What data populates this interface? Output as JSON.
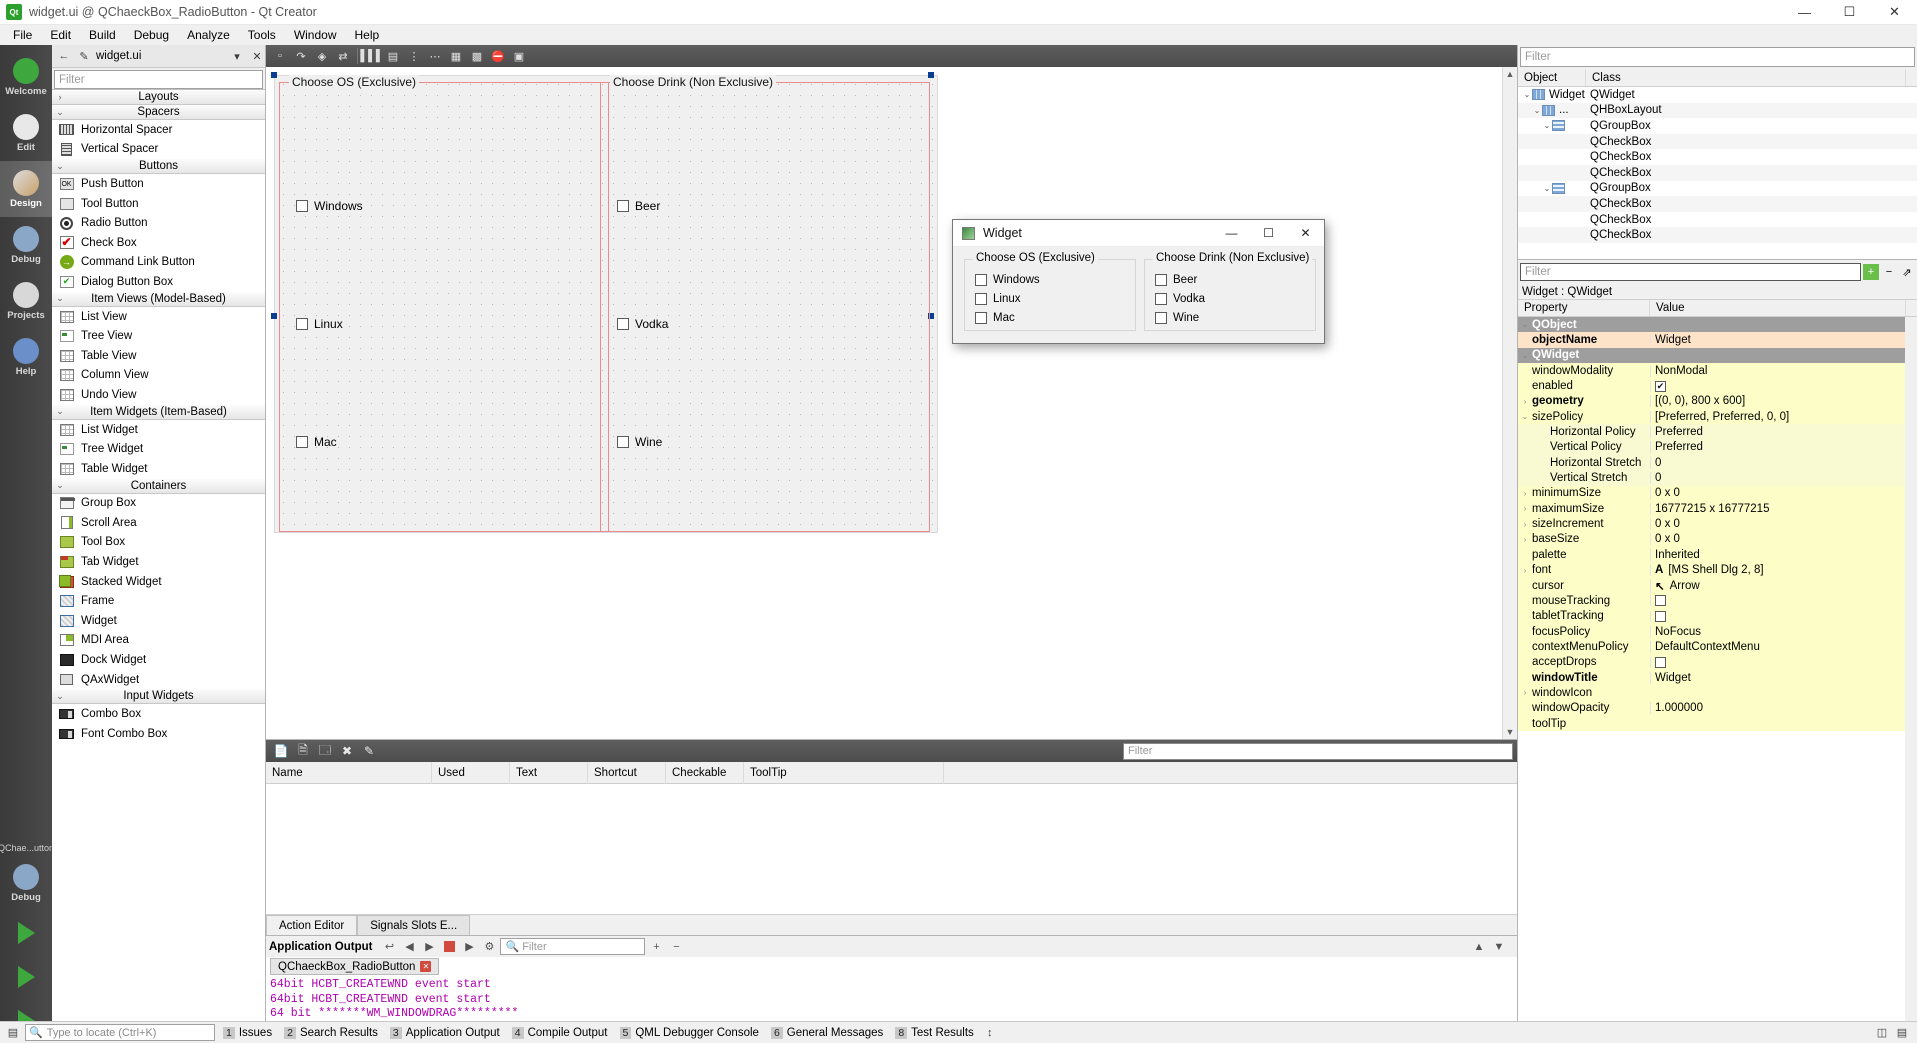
{
  "window": {
    "title": "widget.ui @ QChaeckBox_RadioButton - Qt Creator",
    "icon": "qt-logo-icon",
    "minimize": "—",
    "maximize": "☐",
    "close": "✕"
  },
  "menubar": [
    "File",
    "Edit",
    "Build",
    "Debug",
    "Analyze",
    "Tools",
    "Window",
    "Help"
  ],
  "modebar": {
    "items": [
      {
        "label": "Welcome",
        "icon": "qt-welcome-icon"
      },
      {
        "label": "Edit",
        "icon": "edit-icon"
      },
      {
        "label": "Design",
        "icon": "design-brush-icon"
      },
      {
        "label": "Debug",
        "icon": "debug-bug-icon"
      },
      {
        "label": "Projects",
        "icon": "projects-book-icon"
      },
      {
        "label": "Help",
        "icon": "help-question-icon"
      }
    ],
    "active": "Design",
    "kit_label": "QChae...utton",
    "run_config": "Debug"
  },
  "editor_tab": {
    "filename": "widget.ui",
    "icon": "file-ui-icon"
  },
  "widgetbox": {
    "filter_placeholder": "Filter",
    "categories": [
      {
        "name": "Layouts",
        "expanded": false,
        "items": []
      },
      {
        "name": "Spacers",
        "expanded": true,
        "items": [
          {
            "label": "Horizontal Spacer",
            "icon": "horizontal-spacer-icon"
          },
          {
            "label": "Vertical Spacer",
            "icon": "vertical-spacer-icon"
          }
        ]
      },
      {
        "name": "Buttons",
        "expanded": true,
        "items": [
          {
            "label": "Push Button",
            "icon": "push-button-icon"
          },
          {
            "label": "Tool Button",
            "icon": "tool-button-icon"
          },
          {
            "label": "Radio Button",
            "icon": "radio-button-icon"
          },
          {
            "label": "Check Box",
            "icon": "check-box-icon"
          },
          {
            "label": "Command Link Button",
            "icon": "command-link-icon"
          },
          {
            "label": "Dialog Button Box",
            "icon": "dialog-button-box-icon"
          }
        ]
      },
      {
        "name": "Item Views (Model-Based)",
        "expanded": true,
        "items": [
          {
            "label": "List View",
            "icon": "list-view-icon"
          },
          {
            "label": "Tree View",
            "icon": "tree-view-icon"
          },
          {
            "label": "Table View",
            "icon": "table-view-icon"
          },
          {
            "label": "Column View",
            "icon": "column-view-icon"
          },
          {
            "label": "Undo View",
            "icon": "undo-view-icon"
          }
        ]
      },
      {
        "name": "Item Widgets (Item-Based)",
        "expanded": true,
        "items": [
          {
            "label": "List Widget",
            "icon": "list-widget-icon"
          },
          {
            "label": "Tree Widget",
            "icon": "tree-widget-icon"
          },
          {
            "label": "Table Widget",
            "icon": "table-widget-icon"
          }
        ]
      },
      {
        "name": "Containers",
        "expanded": true,
        "items": [
          {
            "label": "Group Box",
            "icon": "group-box-icon"
          },
          {
            "label": "Scroll Area",
            "icon": "scroll-area-icon"
          },
          {
            "label": "Tool Box",
            "icon": "tool-box-icon"
          },
          {
            "label": "Tab Widget",
            "icon": "tab-widget-icon"
          },
          {
            "label": "Stacked Widget",
            "icon": "stacked-widget-icon"
          },
          {
            "label": "Frame",
            "icon": "frame-icon"
          },
          {
            "label": "Widget",
            "icon": "widget-icon"
          },
          {
            "label": "MDI Area",
            "icon": "mdi-area-icon"
          },
          {
            "label": "Dock Widget",
            "icon": "dock-widget-icon"
          },
          {
            "label": "QAxWidget",
            "icon": "qax-widget-icon"
          }
        ]
      },
      {
        "name": "Input Widgets",
        "expanded": true,
        "items": [
          {
            "label": "Combo Box",
            "icon": "combo-box-icon"
          },
          {
            "label": "Font Combo Box",
            "icon": "font-combo-box-icon"
          }
        ]
      }
    ]
  },
  "form": {
    "groupboxes": [
      {
        "title": "Choose OS (Exclusive)",
        "checkboxes": [
          "Windows",
          "Linux",
          "Mac"
        ]
      },
      {
        "title": "Choose Drink (Non Exclusive)",
        "checkboxes": [
          "Beer",
          "Vodka",
          "Wine"
        ]
      }
    ]
  },
  "preview": {
    "title": "Widget",
    "icon": "widget-preview-icon",
    "minimize": "—",
    "maximize": "☐",
    "close": "✕",
    "groupboxes": [
      {
        "title": "Choose OS (Exclusive)",
        "checkboxes": [
          "Windows",
          "Linux",
          "Mac"
        ]
      },
      {
        "title": "Choose Drink (Non Exclusive)",
        "checkboxes": [
          "Beer",
          "Vodka",
          "Wine"
        ]
      }
    ]
  },
  "action_editor": {
    "filter_placeholder": "Filter",
    "columns": [
      "Name",
      "Used",
      "Text",
      "Shortcut",
      "Checkable",
      "ToolTip"
    ],
    "tabs": [
      {
        "label": "Action Editor",
        "active": true
      },
      {
        "label": "Signals  Slots E...",
        "active": false
      }
    ]
  },
  "object_inspector": {
    "filter_placeholder": "Filter",
    "columns": [
      "Object",
      "Class"
    ],
    "rows": [
      {
        "indent": 0,
        "expander": "⌄",
        "icon": "layout-icon",
        "object": "Widget",
        "class": "QWidget"
      },
      {
        "indent": 1,
        "expander": "⌄",
        "icon": "layout-icon",
        "object": "...",
        "class": "QHBoxLayout"
      },
      {
        "indent": 2,
        "expander": "⌄",
        "icon": "groupbox-icon",
        "object": "",
        "class": "QGroupBox"
      },
      {
        "indent": 3,
        "expander": "",
        "icon": "",
        "object": "",
        "class": "QCheckBox"
      },
      {
        "indent": 3,
        "expander": "",
        "icon": "",
        "object": "",
        "class": "QCheckBox"
      },
      {
        "indent": 3,
        "expander": "",
        "icon": "",
        "object": "",
        "class": "QCheckBox"
      },
      {
        "indent": 2,
        "expander": "⌄",
        "icon": "groupbox-icon",
        "object": "",
        "class": "QGroupBox"
      },
      {
        "indent": 3,
        "expander": "",
        "icon": "",
        "object": "",
        "class": "QCheckBox"
      },
      {
        "indent": 3,
        "expander": "",
        "icon": "",
        "object": "",
        "class": "QCheckBox"
      },
      {
        "indent": 3,
        "expander": "",
        "icon": "",
        "object": "",
        "class": "QCheckBox"
      }
    ]
  },
  "property_editor": {
    "filter_placeholder": "Filter",
    "add_button": "+",
    "remove_button": "−",
    "config_button": "⇗",
    "object_header": "Widget : QWidget",
    "columns": [
      "Property",
      "Value"
    ],
    "rows": [
      {
        "kind": "group",
        "expander": "⌄",
        "name": "QObject",
        "value": "",
        "indent": 0
      },
      {
        "kind": "hl",
        "expander": "",
        "name": "objectName",
        "bold": true,
        "value": "Widget",
        "indent": 1
      },
      {
        "kind": "group",
        "expander": "⌄",
        "name": "QWidget",
        "value": "",
        "indent": 0
      },
      {
        "kind": "y",
        "expander": "",
        "name": "windowModality",
        "value": "NonModal",
        "indent": 1
      },
      {
        "kind": "y",
        "expander": "",
        "name": "enabled",
        "value": "",
        "checkbox": true,
        "checked": true,
        "indent": 1
      },
      {
        "kind": "y",
        "expander": "›",
        "name": "geometry",
        "bold": true,
        "value": "[(0, 0), 800 x 600]",
        "indent": 1
      },
      {
        "kind": "y",
        "expander": "⌄",
        "name": "sizePolicy",
        "value": "[Preferred, Preferred, 0, 0]",
        "indent": 1
      },
      {
        "kind": "y2",
        "expander": "",
        "name": "Horizontal Policy",
        "value": "Preferred",
        "indent": 2
      },
      {
        "kind": "y2",
        "expander": "",
        "name": "Vertical Policy",
        "value": "Preferred",
        "indent": 2
      },
      {
        "kind": "y2",
        "expander": "",
        "name": "Horizontal Stretch",
        "value": "0",
        "indent": 2
      },
      {
        "kind": "y2",
        "expander": "",
        "name": "Vertical Stretch",
        "value": "0",
        "indent": 2
      },
      {
        "kind": "y",
        "expander": "›",
        "name": "minimumSize",
        "value": "0 x 0",
        "indent": 1
      },
      {
        "kind": "y",
        "expander": "›",
        "name": "maximumSize",
        "value": "16777215 x 16777215",
        "indent": 1
      },
      {
        "kind": "y",
        "expander": "›",
        "name": "sizeIncrement",
        "value": "0 x 0",
        "indent": 1
      },
      {
        "kind": "y",
        "expander": "›",
        "name": "baseSize",
        "value": "0 x 0",
        "indent": 1
      },
      {
        "kind": "y",
        "expander": "",
        "name": "palette",
        "value": "Inherited",
        "indent": 1
      },
      {
        "kind": "y",
        "expander": "›",
        "name": "font",
        "value": "[MS Shell Dlg 2, 8]",
        "prefix": "A",
        "indent": 1
      },
      {
        "kind": "y",
        "expander": "",
        "name": "cursor",
        "value": "Arrow",
        "prefix": "↖",
        "indent": 1
      },
      {
        "kind": "y",
        "expander": "",
        "name": "mouseTracking",
        "value": "",
        "checkbox": true,
        "checked": false,
        "indent": 1
      },
      {
        "kind": "y",
        "expander": "",
        "name": "tabletTracking",
        "value": "",
        "checkbox": true,
        "checked": false,
        "indent": 1
      },
      {
        "kind": "y",
        "expander": "",
        "name": "focusPolicy",
        "value": "NoFocus",
        "indent": 1
      },
      {
        "kind": "y",
        "expander": "",
        "name": "contextMenuPolicy",
        "value": "DefaultContextMenu",
        "indent": 1
      },
      {
        "kind": "y",
        "expander": "",
        "name": "acceptDrops",
        "value": "",
        "checkbox": true,
        "checked": false,
        "indent": 1
      },
      {
        "kind": "y",
        "expander": "",
        "name": "windowTitle",
        "bold": true,
        "value": "Widget",
        "indent": 1
      },
      {
        "kind": "y",
        "expander": "›",
        "name": "windowIcon",
        "value": "",
        "indent": 1
      },
      {
        "kind": "y",
        "expander": "",
        "name": "windowOpacity",
        "value": "1.000000",
        "indent": 1
      },
      {
        "kind": "y",
        "expander": "",
        "name": "toolTip",
        "value": "",
        "indent": 1
      }
    ]
  },
  "application_output": {
    "title": "Application Output",
    "filter_placeholder": "Filter",
    "tab": "QChaeckBox_RadioButton",
    "lines": [
      "64bit HCBT_CREATEWND event start",
      "64bit HCBT_CREATEWND event start",
      "64 bit *******WM_WINDOWDRAG*********"
    ]
  },
  "statusbar": {
    "locate_placeholder": "Type to locate (Ctrl+K)",
    "items": [
      {
        "num": "1",
        "label": "Issues"
      },
      {
        "num": "2",
        "label": "Search Results"
      },
      {
        "num": "3",
        "label": "Application Output"
      },
      {
        "num": "4",
        "label": "Compile Output"
      },
      {
        "num": "5",
        "label": "QML Debugger Console"
      },
      {
        "num": "6",
        "label": "General Messages"
      },
      {
        "num": "8",
        "label": "Test Results"
      }
    ]
  }
}
